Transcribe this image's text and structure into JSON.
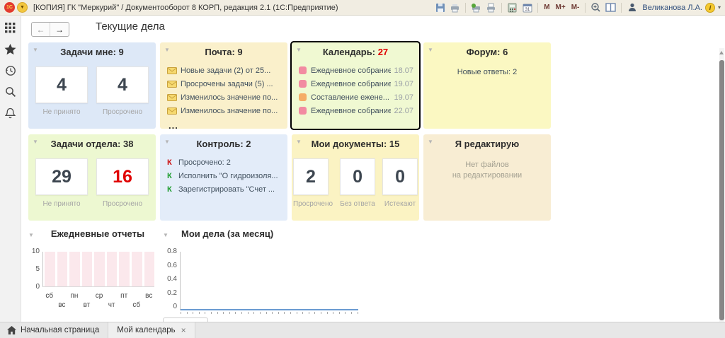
{
  "titlebar": {
    "app_title": "[КОПИЯ] ГК \"Меркурий\" / Документооборот 8 КОРП, редакция 2.1   (1С:Предприятие)",
    "user_name": "Великанова Л.А.",
    "font_scale_buttons": [
      "M",
      "M+",
      "M-"
    ]
  },
  "page": {
    "title": "Текущие дела"
  },
  "tiles": {
    "tasks_me": {
      "title": "Задачи мне: 9",
      "counters": [
        {
          "value": "4",
          "label": "Не принято",
          "color": "#3d4650"
        },
        {
          "value": "4",
          "label": "Просрочено",
          "color": "#3d4650"
        }
      ]
    },
    "mail": {
      "title": "Почта: 9",
      "items": [
        "Новые задачи (2) от 25...",
        "Просрочены задачи (5) ...",
        "Изменилось значение по...",
        "Изменилось значение по..."
      ],
      "more": "..."
    },
    "calendar": {
      "title_prefix": "Календарь: ",
      "count": "27",
      "count_color": "#e00000",
      "items": [
        {
          "text": "Ежедневное собрание",
          "date": "18.07",
          "icon_color": "#f28ba1"
        },
        {
          "text": "Ежедневное собрание",
          "date": "19.07",
          "icon_color": "#f28ba1"
        },
        {
          "text": "Составление ежене...",
          "date": "19.07",
          "icon_color": "#f5ad67"
        },
        {
          "text": "Ежедневное собрание",
          "date": "22.07",
          "icon_color": "#f28ba1"
        }
      ]
    },
    "forum": {
      "title": "Форум: 6",
      "subtitle": "Новые ответы: 2"
    },
    "dept_tasks": {
      "title": "Задачи отдела: 38",
      "counters": [
        {
          "value": "29",
          "label": "Не принято",
          "color": "#3d4650"
        },
        {
          "value": "16",
          "label": "Просрочено",
          "color": "#e00000"
        }
      ]
    },
    "control": {
      "title": "Контроль: 2",
      "items": [
        {
          "marker": "К",
          "marker_color": "#cc1111",
          "text": "Просрочено: 2"
        },
        {
          "marker": "К",
          "marker_color": "#1f9d2f",
          "text": "Исполнить \"О гидроизоля..."
        },
        {
          "marker": "К",
          "marker_color": "#1f9d2f",
          "text": "Зарегистрировать \"Счет ..."
        }
      ]
    },
    "my_docs": {
      "title": "Мои документы: 15",
      "counters": [
        {
          "value": "2",
          "label": "Просрочено",
          "color": "#3d4650"
        },
        {
          "value": "0",
          "label": "Без ответа",
          "color": "#3d4650"
        },
        {
          "value": "0",
          "label": "Истекают",
          "color": "#3d4650"
        }
      ]
    },
    "editing": {
      "title": "Я редактирую",
      "empty_line1": "Нет файлов",
      "empty_line2": "на редактировании"
    }
  },
  "chart_data": [
    {
      "type": "bar",
      "title": "Ежедневные отчеты",
      "categories": [
        "сб",
        "вс",
        "пн",
        "вт",
        "ср",
        "чт",
        "пт",
        "сб",
        "вс"
      ],
      "values": [
        10,
        10,
        10,
        10,
        10,
        10,
        10,
        10,
        10
      ],
      "ylim": [
        0,
        10
      ],
      "yticks": [
        10,
        5,
        0
      ],
      "bar_color": "#fbe8ec",
      "grid": false,
      "legend": "none"
    },
    {
      "type": "line",
      "title": "Мои дела (за месяц)",
      "values": [
        0,
        0,
        0,
        0,
        0,
        0,
        0,
        0,
        0,
        0,
        0,
        0,
        0,
        0,
        0,
        0,
        0,
        0,
        0,
        0,
        0,
        0,
        0,
        0,
        0,
        0,
        0,
        0,
        0,
        0
      ],
      "x_tick_count": 30,
      "ylim": [
        0,
        0.8
      ],
      "yticks": [
        0.8,
        0.6,
        0.4,
        0.2,
        0
      ],
      "line_color": "#6b9bd2",
      "grid": false,
      "legend": "none"
    }
  ],
  "tabbar": {
    "tabs": [
      {
        "label": "Начальная страница"
      },
      {
        "label": "Мой календарь",
        "close_label": "×"
      }
    ]
  },
  "colors": {
    "accent_red": "#e00000"
  }
}
